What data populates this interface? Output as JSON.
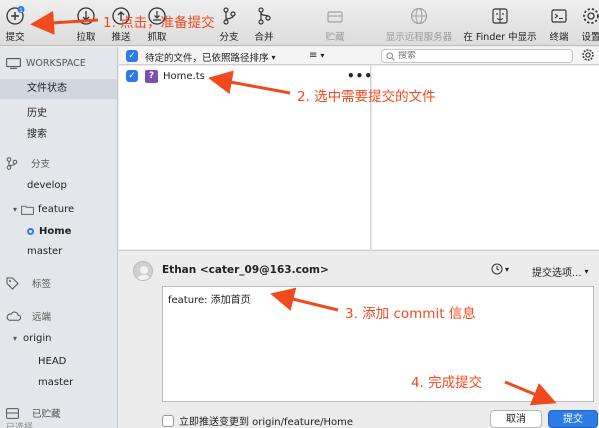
{
  "toolbar": {
    "items": [
      {
        "label": "提交",
        "icon": "commit-plus-icon",
        "badge": "1"
      },
      {
        "label": "拉取",
        "icon": "pull-down-icon"
      },
      {
        "label": "推送",
        "icon": "push-up-icon"
      },
      {
        "label": "抓取",
        "icon": "fetch-icon"
      },
      {
        "label": "分支",
        "icon": "branch-icon"
      },
      {
        "label": "合并",
        "icon": "merge-icon"
      },
      {
        "label": "贮藏",
        "icon": "stash-icon"
      },
      {
        "label": "显示远程服务器",
        "icon": "globe-icon"
      },
      {
        "label": "在 Finder 中显示",
        "icon": "finder-icon"
      },
      {
        "label": "终端",
        "icon": "terminal-icon"
      },
      {
        "label": "设置",
        "icon": "gear-icon"
      }
    ]
  },
  "sidebar": {
    "workspace": "WORKSPACE",
    "workspace_items": [
      "文件状态",
      "历史",
      "搜索"
    ],
    "branches_header": "分支",
    "branches": [
      "develop",
      "feature",
      "Home",
      "master"
    ],
    "tags_header": "标签",
    "remotes_header": "远端",
    "remote_name": "origin",
    "remote_branches": [
      "HEAD",
      "master"
    ],
    "stashes_header": "已贮藏",
    "bottom_text": "已选择"
  },
  "filebar": {
    "sort_label": "待定的文件，已依照路径排序",
    "search_placeholder": "搜索"
  },
  "files": [
    {
      "name": "Home.ts",
      "status": "?"
    }
  ],
  "commit": {
    "author": "Ethan <cater_09@163.com>",
    "options_label": "提交选项...",
    "message": "feature: 添加首页",
    "push_label": "立即推送变更到 origin/feature/Home",
    "cancel_label": "取消",
    "submit_label": "提交"
  },
  "annotations": {
    "step1": "1. 点击，准备提交",
    "step2": "2. 选中需要提交的文件",
    "step3": "3. 添加 commit 信息",
    "step4": "4. 完成提交"
  },
  "colors": {
    "accent": "#2d7be5",
    "annotation": "#f04a1f"
  }
}
